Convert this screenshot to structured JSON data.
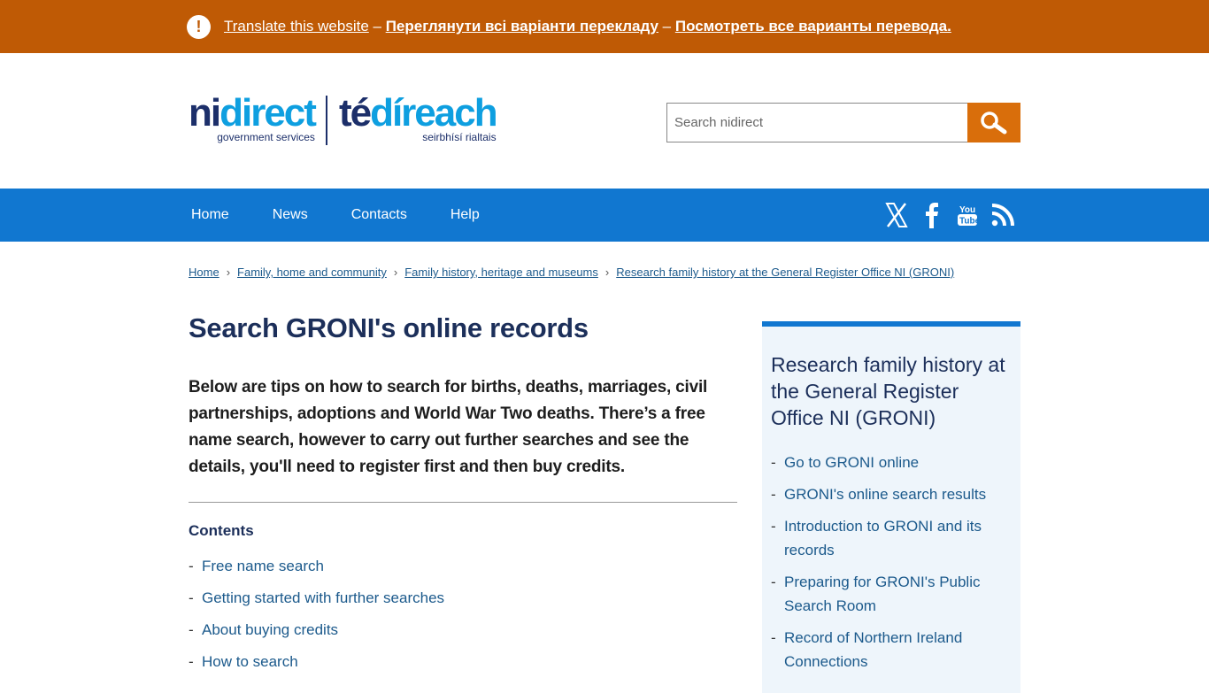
{
  "translate_bar": {
    "alert_symbol": "!",
    "link_1": "Translate this website",
    "sep": " – ",
    "link_2": "Переглянути всі варіанти перекладу",
    "link_3": "Посмотреть все варианты перевода."
  },
  "logo": {
    "en_ni": "ni",
    "en_direct": "direct",
    "en_sub": "government services",
    "ga_te": "té",
    "ga_direach": "díreach",
    "ga_sub": "seirbhísí rialtais"
  },
  "search": {
    "placeholder": "Search nidirect",
    "icon": "search-icon"
  },
  "nav": {
    "items": [
      "Home",
      "News",
      "Contacts",
      "Help"
    ],
    "social_icons": [
      "x-icon",
      "facebook-icon",
      "youtube-icon",
      "rss-icon"
    ]
  },
  "breadcrumb": {
    "items": [
      "Home",
      "Family, home and community",
      "Family history, heritage and museums",
      "Research family history at the General Register Office NI (GRONI)"
    ],
    "separator": "›"
  },
  "main": {
    "title": "Search GRONI's online records",
    "summary": "Below are tips on how to search for births, deaths, marriages, civil partnerships, adoptions and World War Two deaths. There’s a free name search, however to carry out further searches and see the details, you'll need to register first and then buy credits.",
    "contents_title": "Contents",
    "contents": [
      "Free name search",
      "Getting started with further searches",
      "About buying credits",
      "How to search"
    ]
  },
  "sidebar": {
    "title": "Research family history at the General Register Office NI (GRONI)",
    "links": [
      "Go to GRONI online",
      "GRONI's online search results",
      "Introduction to GRONI and its records",
      "Preparing for GRONI's Public Search Room",
      "Record of Northern Ireland Connections"
    ]
  },
  "colors": {
    "translate_bar": "#bf5a05",
    "nav": "#1177d0",
    "search_button": "#d96e0b",
    "sidebar_bg": "#eef5fb"
  }
}
